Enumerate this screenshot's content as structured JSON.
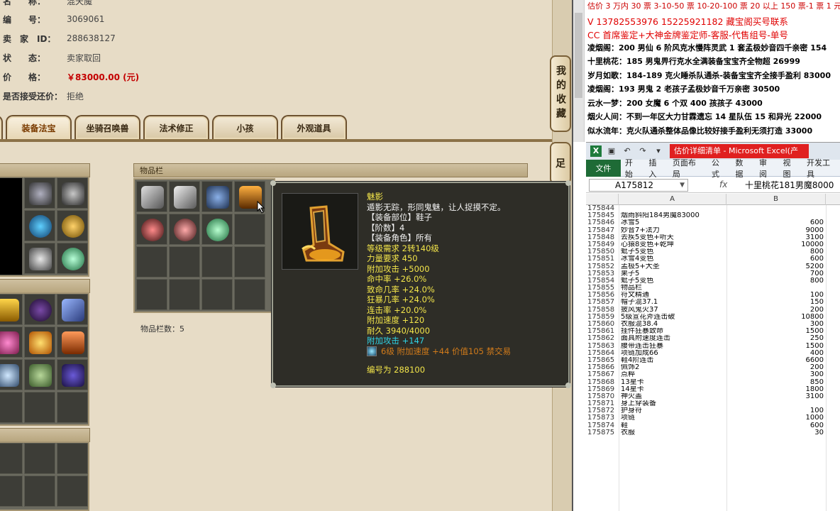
{
  "listing": {
    "name_label": "名　　称：",
    "name_value": "混天魔",
    "id_label": "编　　号：",
    "id_value": "3069061",
    "seller_label": "卖　家　ID：",
    "seller_value": "288638127",
    "status_label": "状　　态：",
    "status_value": "卖家取回",
    "price_label": "价　　格：",
    "price_value": "￥83000.00 (元)",
    "bargain_label": "是否接受还价：",
    "bargain_value": "拒绝"
  },
  "tabs": [
    "",
    "装备法宝",
    "坐骑召唤兽",
    "法术修正",
    "小孩",
    "外观道具"
  ],
  "inventory": {
    "title": "物品栏",
    "count_label": "物品栏数：5"
  },
  "side_buttons": {
    "favorite": "我的收藏",
    "second": "足"
  },
  "tooltip": {
    "name": "魅影",
    "desc": "遁影无踪，形同鬼魅，让人捉摸不定。",
    "slot": "【装备部位】鞋子",
    "tier": "【阶数】4",
    "role": "【装备角色】所有",
    "level_req": "等级需求 2转140级",
    "str_req": "力量要求 450",
    "atk_bonus": "附加攻击 +5000",
    "hit": "命中率 +26.0%",
    "crit": "致命几率 +24.0%",
    "rage": "狂暴几率 +24.0%",
    "combo": "连击率 +20.0%",
    "speed": "附加速度 +120",
    "durability": "耐久 3940/4000",
    "extra_atk": "附加攻击 +147",
    "gem": "6级 附加速度 +44 价值105 禁交易",
    "serial": "编号为 288100"
  },
  "doc_lines": [
    "估价 3 万内 30 票  3-10-50 票  10-20-100 票 20 以上 150 票-1 票 1 元",
    "V 13782553976    15225921182  藏宝阁买号联系",
    "CC 首席鉴定+大神金牌鉴定师-客服-代售组号-单号",
    "凌烟阁：200 男仙 6 阶风克水慢阵灵武 1 套孟极妙音四千亲密 154",
    "十里桃花：185 男鬼畀行克水全满装备宝宝齐全物超 26999",
    "岁月如歌：184-189 克火睡杀队通杀-装备宝宝齐全接手盈利 83000",
    "凌烟阁：193 男鬼 2 老孩子孟极妙音千万亲密 30500",
    "云水一梦：200 女魔 6 个双 400 孩孩子 43000",
    "烟火人间：不到一年区大力甘霖遗忘 14 星队伍 15 和异光 22000",
    "似水流年：克火队通杀整体品像比较好接手盈利无须打造 33000"
  ],
  "excel": {
    "window_title": "估价详细清单 - Microsoft Excel(产",
    "file_tab": "文件",
    "ribbon_tabs": [
      "开始",
      "插入",
      "页面布局",
      "公式",
      "数据",
      "审阅",
      "视图",
      "开发工具"
    ],
    "name_box": "A175812",
    "fx": "fx",
    "formula_value": "十里桃花181男魔8000",
    "col_a": "A",
    "col_b": "B",
    "rows": [
      {
        "n": "175844",
        "a": "",
        "b": ""
      },
      {
        "n": "175845",
        "a": "烟雨斜阳184男魔83000",
        "b": ""
      },
      {
        "n": "175846",
        "a": "冰雪5",
        "b": "600"
      },
      {
        "n": "175847",
        "a": "妙音7+法力",
        "b": "9000"
      },
      {
        "n": "175848",
        "a": "去疾5变色+听天",
        "b": "3100"
      },
      {
        "n": "175849",
        "a": "心猿8变色+乾坤",
        "b": "10000"
      },
      {
        "n": "175850",
        "a": "蚍子5变色",
        "b": "800"
      },
      {
        "n": "175851",
        "a": "冰雪4变色",
        "b": "600"
      },
      {
        "n": "175852",
        "a": "孟极5+大圣",
        "b": "5200"
      },
      {
        "n": "175853",
        "a": "果子5",
        "b": "700"
      },
      {
        "n": "175854",
        "a": "蚍子5变色",
        "b": "800"
      },
      {
        "n": "175855",
        "a": "物品栏",
        "b": ""
      },
      {
        "n": "175856",
        "a": "符文精通",
        "b": "100"
      },
      {
        "n": "175857",
        "a": "帽子混37.1",
        "b": "150"
      },
      {
        "n": "175858",
        "a": "披风鬼火37",
        "b": "200"
      },
      {
        "n": "175859",
        "a": "5级宣花斧连击破",
        "b": "10800"
      },
      {
        "n": "175860",
        "a": "衣服混38.4",
        "b": "300"
      },
      {
        "n": "175861",
        "a": "挂件狂暴致命",
        "b": "1500"
      },
      {
        "n": "175862",
        "a": "面具附速度连击",
        "b": "250"
      },
      {
        "n": "175863",
        "a": "腰带连击狂暴",
        "b": "1500"
      },
      {
        "n": "175864",
        "a": "项链加成66",
        "b": "400"
      },
      {
        "n": "175865",
        "a": "鞋4阶连击",
        "b": "6600"
      },
      {
        "n": "175866",
        "a": "佩饰2",
        "b": "200"
      },
      {
        "n": "175867",
        "a": "点粹",
        "b": "300"
      },
      {
        "n": "175868",
        "a": "13星卡",
        "b": "850"
      },
      {
        "n": "175869",
        "a": "14星卡",
        "b": "1800"
      },
      {
        "n": "175870",
        "a": "神火盖",
        "b": "3100"
      },
      {
        "n": "175871",
        "a": "身上穿装备",
        "b": ""
      },
      {
        "n": "175872",
        "a": "护身符",
        "b": "100"
      },
      {
        "n": "175873",
        "a": "项链",
        "b": "1000"
      },
      {
        "n": "175874",
        "a": "鞋",
        "b": "600"
      },
      {
        "n": "175875",
        "a": "衣服",
        "b": "30"
      }
    ]
  },
  "colors": {
    "price": "#c40000",
    "tooltip_bg": "#2e2d27",
    "excel_green": "#1e6b36",
    "doc_red": "#e00000"
  }
}
